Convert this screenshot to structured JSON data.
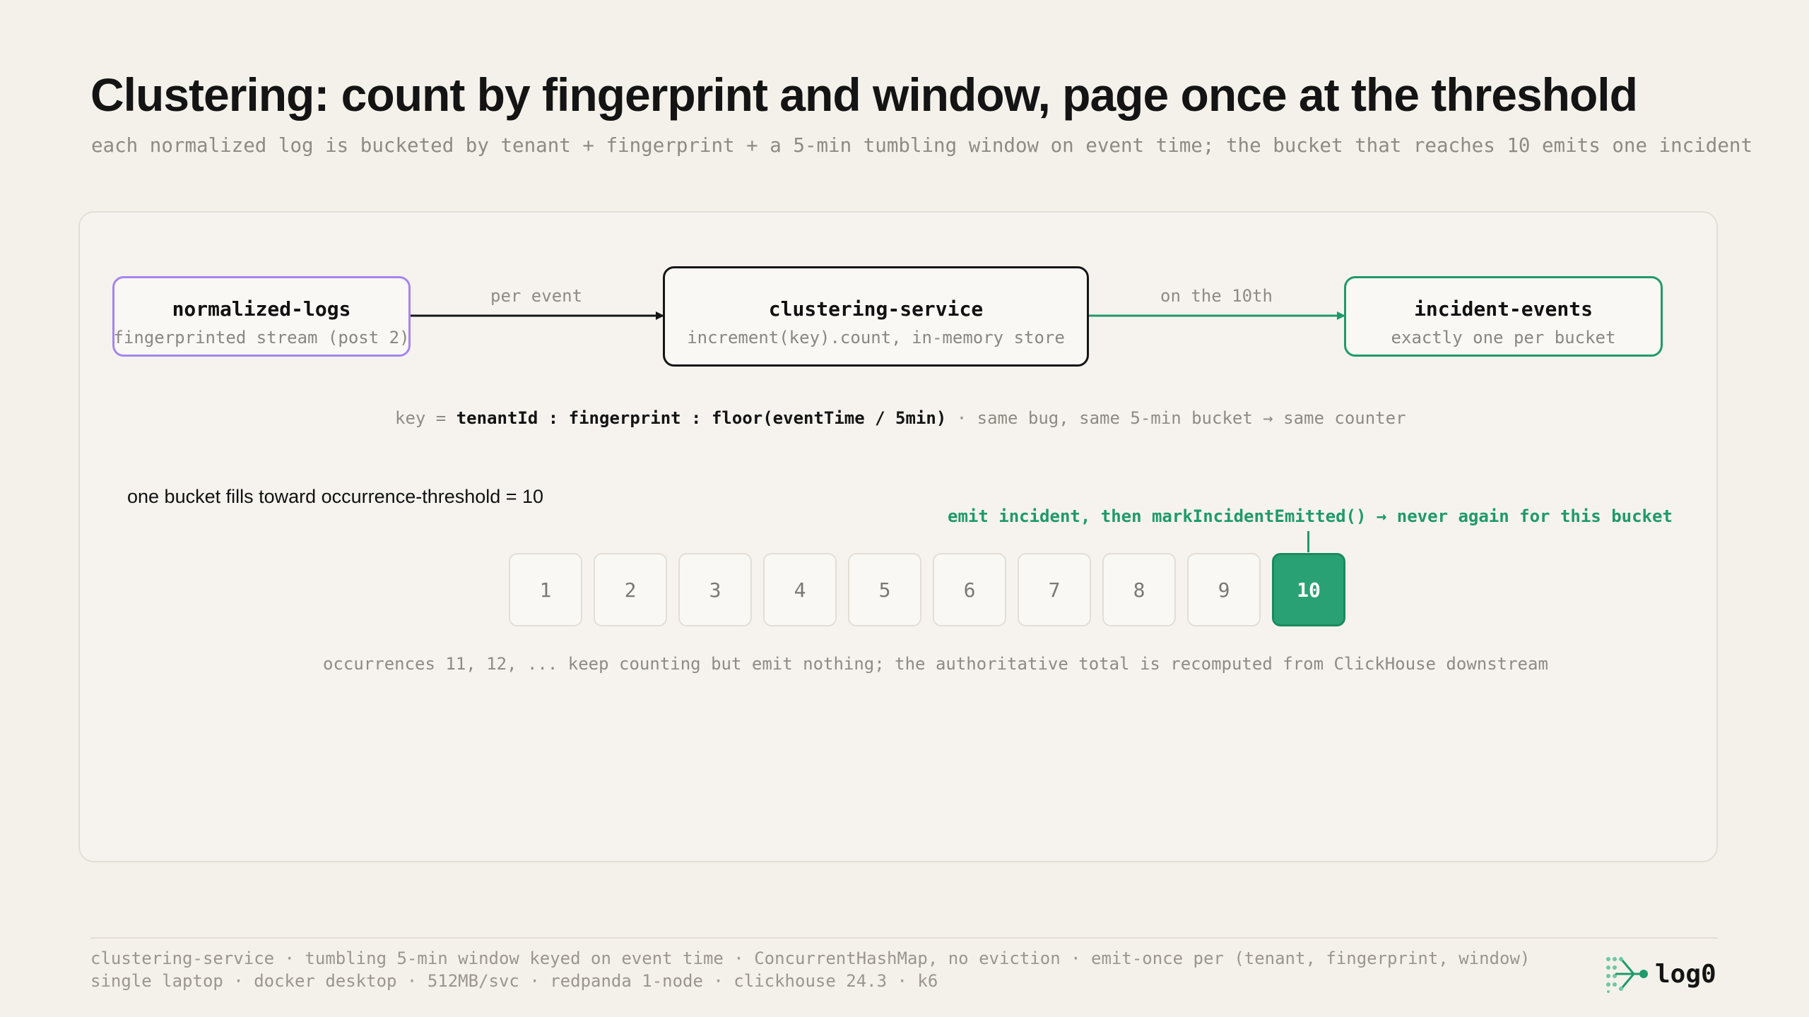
{
  "title": "Clustering: count by fingerprint and window, page once at the threshold",
  "subtitle": "each normalized log is bucketed by tenant + fingerprint + a 5-min tumbling window on event time; the bucket that reaches 10 emits one incident",
  "flow": {
    "source": {
      "name": "normalized-logs",
      "sub": "fingerprinted stream (post 2)",
      "color": "#a685f0"
    },
    "edge1_label": "per event",
    "service": {
      "name": "clustering-service",
      "sub": "increment(key).count, in-memory store",
      "color": "#161616"
    },
    "edge2_label": "on the 10th",
    "sink": {
      "name": "incident-events",
      "sub": "exactly one per bucket",
      "color": "#1f9a6a"
    }
  },
  "key_line": {
    "prefix": "key = ",
    "tenant": "tenantId",
    "sep1": " : ",
    "fingerprint": "fingerprint",
    "sep2": " : ",
    "window": "floor(eventTime / 5min)",
    "suffix": " · same bug, same 5-min bucket → same counter"
  },
  "bucket": {
    "caption": "one bucket fills toward occurrence-threshold = 10",
    "emit_note": "emit incident, then markIncidentEmitted() → never again for this bucket",
    "cells": [
      "1",
      "2",
      "3",
      "4",
      "5",
      "6",
      "7",
      "8",
      "9",
      "10"
    ],
    "threshold": 10,
    "overflow_note": "occurrences 11, 12, ... keep counting but emit nothing; the authoritative total is recomputed from ClickHouse downstream"
  },
  "footer": {
    "line1": "clustering-service · tumbling 5-min window keyed on event time · ConcurrentHashMap, no eviction · emit-once per (tenant, fingerprint, window)",
    "line2": "single laptop · docker desktop · 512MB/svc · redpanda 1-node · clickhouse 24.3 · k6",
    "logo": "log0"
  },
  "colors": {
    "accent_green": "#1f9a6a",
    "purple": "#a685f0",
    "background": "#f4f1eb"
  }
}
